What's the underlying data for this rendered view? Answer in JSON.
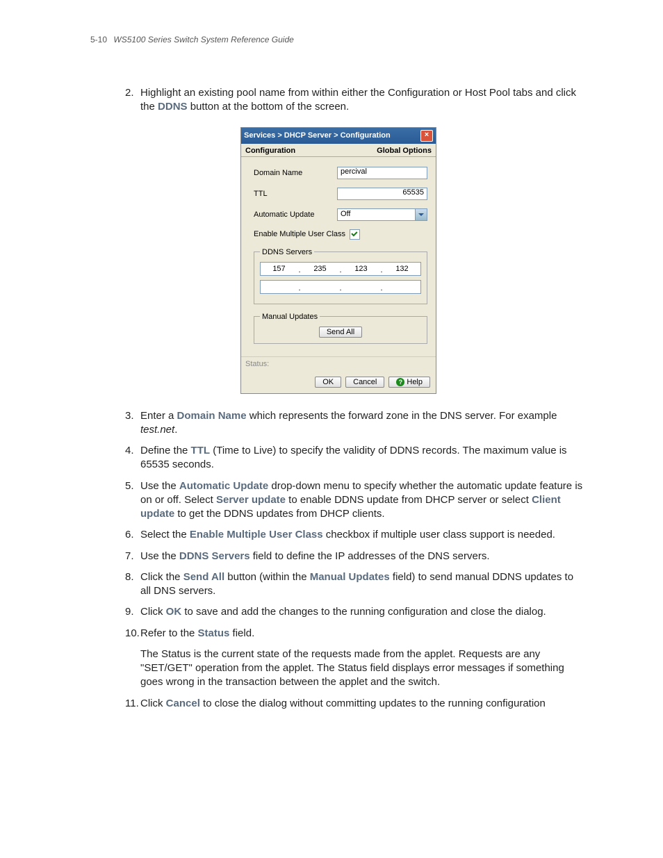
{
  "page": {
    "number": "5-10",
    "title": "WS5100 Series Switch System Reference Guide"
  },
  "dialog": {
    "titlebar": "Services > DHCP Server > Configuration",
    "tabs": {
      "left": "Configuration",
      "right": "Global Options"
    },
    "labels": {
      "domain_name": "Domain Name",
      "ttl": "TTL",
      "auto_update": "Automatic Update",
      "enable_multi": "Enable Multiple User Class",
      "ddns_servers": "DDNS Servers",
      "manual_updates": "Manual Updates",
      "status": "Status:"
    },
    "values": {
      "domain_name": "percival",
      "ttl": "65535",
      "auto_update": "Off",
      "ip1": {
        "a": "157",
        "b": "235",
        "c": "123",
        "d": "132"
      },
      "ip2": {
        "a": "",
        "b": "",
        "c": "",
        "d": ""
      }
    },
    "buttons": {
      "send_all": "Send All",
      "ok": "OK",
      "cancel": "Cancel",
      "help": "Help"
    }
  },
  "steps": {
    "s2a": "Highlight an existing pool name from within either the Configuration or Host Pool tabs and click the ",
    "s2b": " button at the bottom of the screen.",
    "s2bold": "DDNS",
    "s3a": "Enter a ",
    "s3bold": "Domain Name",
    "s3b": " which represents the forward zone in the DNS server. For example ",
    "s3italic": "test.net",
    "s3c": ".",
    "s4a": "Define the ",
    "s4bold": "TTL",
    "s4b": " (Time to Live) to specify the validity of DDNS records. The maximum value is 65535 seconds.",
    "s5a": "Use the ",
    "s5bold1": "Automatic Update",
    "s5b": " drop-down menu to specify whether the automatic update feature is on or off. Select ",
    "s5bold2": "Server update",
    "s5c": " to enable DDNS update from DHCP server or select ",
    "s5bold3": "Client update",
    "s5d": " to get the DDNS updates from DHCP clients.",
    "s6a": "Select the ",
    "s6bold": "Enable Multiple User Class",
    "s6b": " checkbox if multiple user class support is needed.",
    "s7a": "Use the ",
    "s7bold": "DDNS Servers",
    "s7b": " field to define the IP addresses of the DNS servers.",
    "s8a": "Click the ",
    "s8bold1": "Send All",
    "s8b": " button (within the ",
    "s8bold2": "Manual Updates",
    "s8c": " field) to send manual DDNS updates to all DNS servers.",
    "s9a": "Click ",
    "s9bold": "OK",
    "s9b": " to save and add the changes to the running configuration and close the dialog.",
    "s10a": "Refer to the ",
    "s10bold": "Status",
    "s10b": " field.",
    "s10p": "The Status is the current state of the requests made from the applet. Requests are any \"SET/GET\" operation from the applet. The Status field displays error messages if something goes wrong in the transaction between the applet and the switch.",
    "s11a": "Click ",
    "s11bold": "Cancel",
    "s11b": " to close the dialog without committing updates to the running configuration"
  },
  "nums": {
    "n2": "2.",
    "n3": "3.",
    "n4": "4.",
    "n5": "5.",
    "n6": "6.",
    "n7": "7.",
    "n8": "8.",
    "n9": "9.",
    "n10": "10.",
    "n11": "11."
  }
}
